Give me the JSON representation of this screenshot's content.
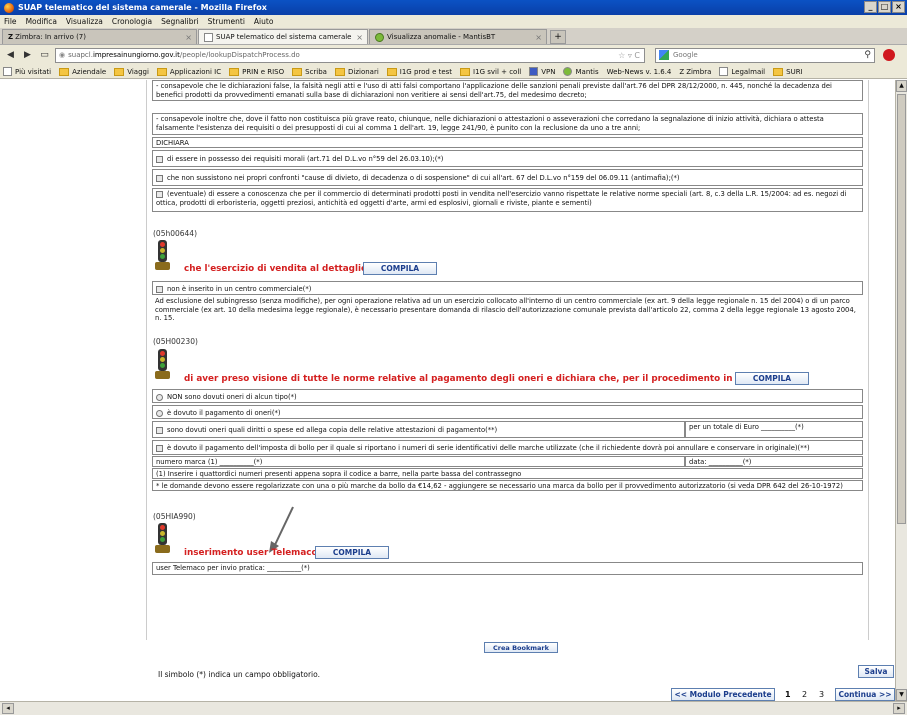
{
  "window": {
    "title": "SUAP telematico del sistema camerale - Mozilla Firefox"
  },
  "menu": [
    "File",
    "Modifica",
    "Visualizza",
    "Cronologia",
    "Segnalibri",
    "Strumenti",
    "Aiuto"
  ],
  "tabs": [
    {
      "label": "Zimbra: In arrivo (7)"
    },
    {
      "label": "SUAP telematico del sistema camerale"
    },
    {
      "label": "Visualizza anomalie - MantisBT"
    }
  ],
  "nav": {
    "url_prefix": "suapcl.",
    "url_domain": "impresainungiorno.gov.it",
    "url_path": "/people/lookupDispatchProcess.do",
    "search_placeholder": "Google"
  },
  "bookmarks": [
    "Più visitati",
    "Aziendale",
    "Viaggi",
    "Applicazioni IC",
    "PRIN e RISO",
    "Scriba",
    "Dizionari",
    "I1G prod e test",
    "I1G svil + coll",
    "VPN",
    "Mantis",
    "Web-News v. 1.6.4",
    "Zimbra",
    "Legalmail",
    "SURI"
  ],
  "form": {
    "top_text_1": "- consapevole che le dichiarazioni false, la falsità negli atti e l'uso di atti falsi comportano l'applicazione delle sanzioni penali previste dall'art.76 del DPR 28/12/2000, n. 445, nonché la decadenza dei benefici prodotti da provvedimenti emanati sulla base di dichiarazioni non veritiere ai sensi dell'art.75, del medesimo decreto;",
    "top_text_2": "- consapevole inoltre che, dove il fatto non costituisca più grave reato, chiunque, nelle dichiarazioni o attestazioni o asseverazioni che corredano la segnalazione di inizio attività, dichiara o attesta falsamente l'esistenza dei requisiti o dei presupposti di cui al comma 1 dell'art. 19, legge 241/90, è punito con la reclusione da uno a tre anni;",
    "dichiara": "DICHIARA",
    "check_1": "di essere in possesso dei requisiti morali (art.71 del D.L.vo n°59 del 26.03.10);(*)",
    "check_2": "che non sussistono nei propri confronti \"cause di divieto, di decadenza o di sospensione\" di cui all'art. 67 del D.L.vo n°159 del 06.09.11 (antimafia);(*)",
    "check_3": "(eventuale) di essere a conoscenza che per il commercio di determinati prodotti posti in vendita nell'esercizio vanno rispettate le relative norme speciali (art. 8, c.3 della L.R. 15/2004: ad es. negozi di ottica, prodotti di erboristeria, oggetti preziosi, antichità ed oggetti d'arte, armi ed esplosivi, giornali e riviste, piante e sementi)",
    "section1_code": "(05h00644)",
    "section1_title": "che l'esercizio di vendita al dettaglio:",
    "compila": "COMPILA",
    "section1_check": "non è inserito in un centro commerciale(*)",
    "section1_text": "Ad esclusione del subingresso (senza modifiche), per ogni operazione relativa ad un un esercizio collocato all'interno di un centro commerciale (ex art. 9 della legge regionale n. 15 del 2004) o di un parco commerciale (ex art. 10 della medesima legge regionale), è necessario presentare domanda di rilascio dell'autorizzazione comunale prevista dall'articolo 22, comma 2 della legge regionale 13 agosto 2004, n. 15.",
    "section2_code": "(05H00230)",
    "section2_title": "di aver preso visione di tutte le norme relative al pagamento degli oneri e dichiara che, per il procedimento in oggetto:",
    "radio_1": "NON sono dovuti oneri di alcun tipo(*)",
    "radio_2": "è dovuto il pagamento di oneri(*)",
    "check_4": "sono dovuti oneri quali diritti o spese ed allega copia delle relative attestazioni di pagamento(**)",
    "totale": "per un totale di Euro __________(*)",
    "check_5": "è dovuto il pagamento dell'imposta di bollo per il quale si riportano i numeri di serie identificativi delle marche utilizzate (che il richiedente dovrà poi annullare e conservare in originale)(**)",
    "numero_marca": "numero marca (1) __________(*)",
    "data": "data: __________(*)",
    "nota_1": "(1) Inserire i quattordici numeri presenti appena sopra il codice a barre, nella parte bassa del contrassegno",
    "nota_2": "* le domande devono essere regolarizzate con una o più marche da bollo da €14,62 - aggiungere se necessario una marca da bollo per il provvedimento autorizzatorio (si veda DPR 642 del 26-10-1972)",
    "section3_code": "(05HIA990)",
    "section3_title": "inserimento user Telemaco",
    "user_telemaco": "user Telemaco per invio pratica: __________(*)"
  },
  "footer": {
    "crea_bookmark": "Crea Bookmark",
    "obbligatorio": "Il simbolo (*) indica un campo obbligatorio.",
    "salva": "Salva",
    "prev": "<< Modulo Precedente",
    "pages": [
      "1",
      "2",
      "3"
    ],
    "next": "Continua >>"
  },
  "colors": {
    "accent_red": "#d42020",
    "button_blue": "#1b3d8c",
    "titlebar": "#0b52c4"
  }
}
